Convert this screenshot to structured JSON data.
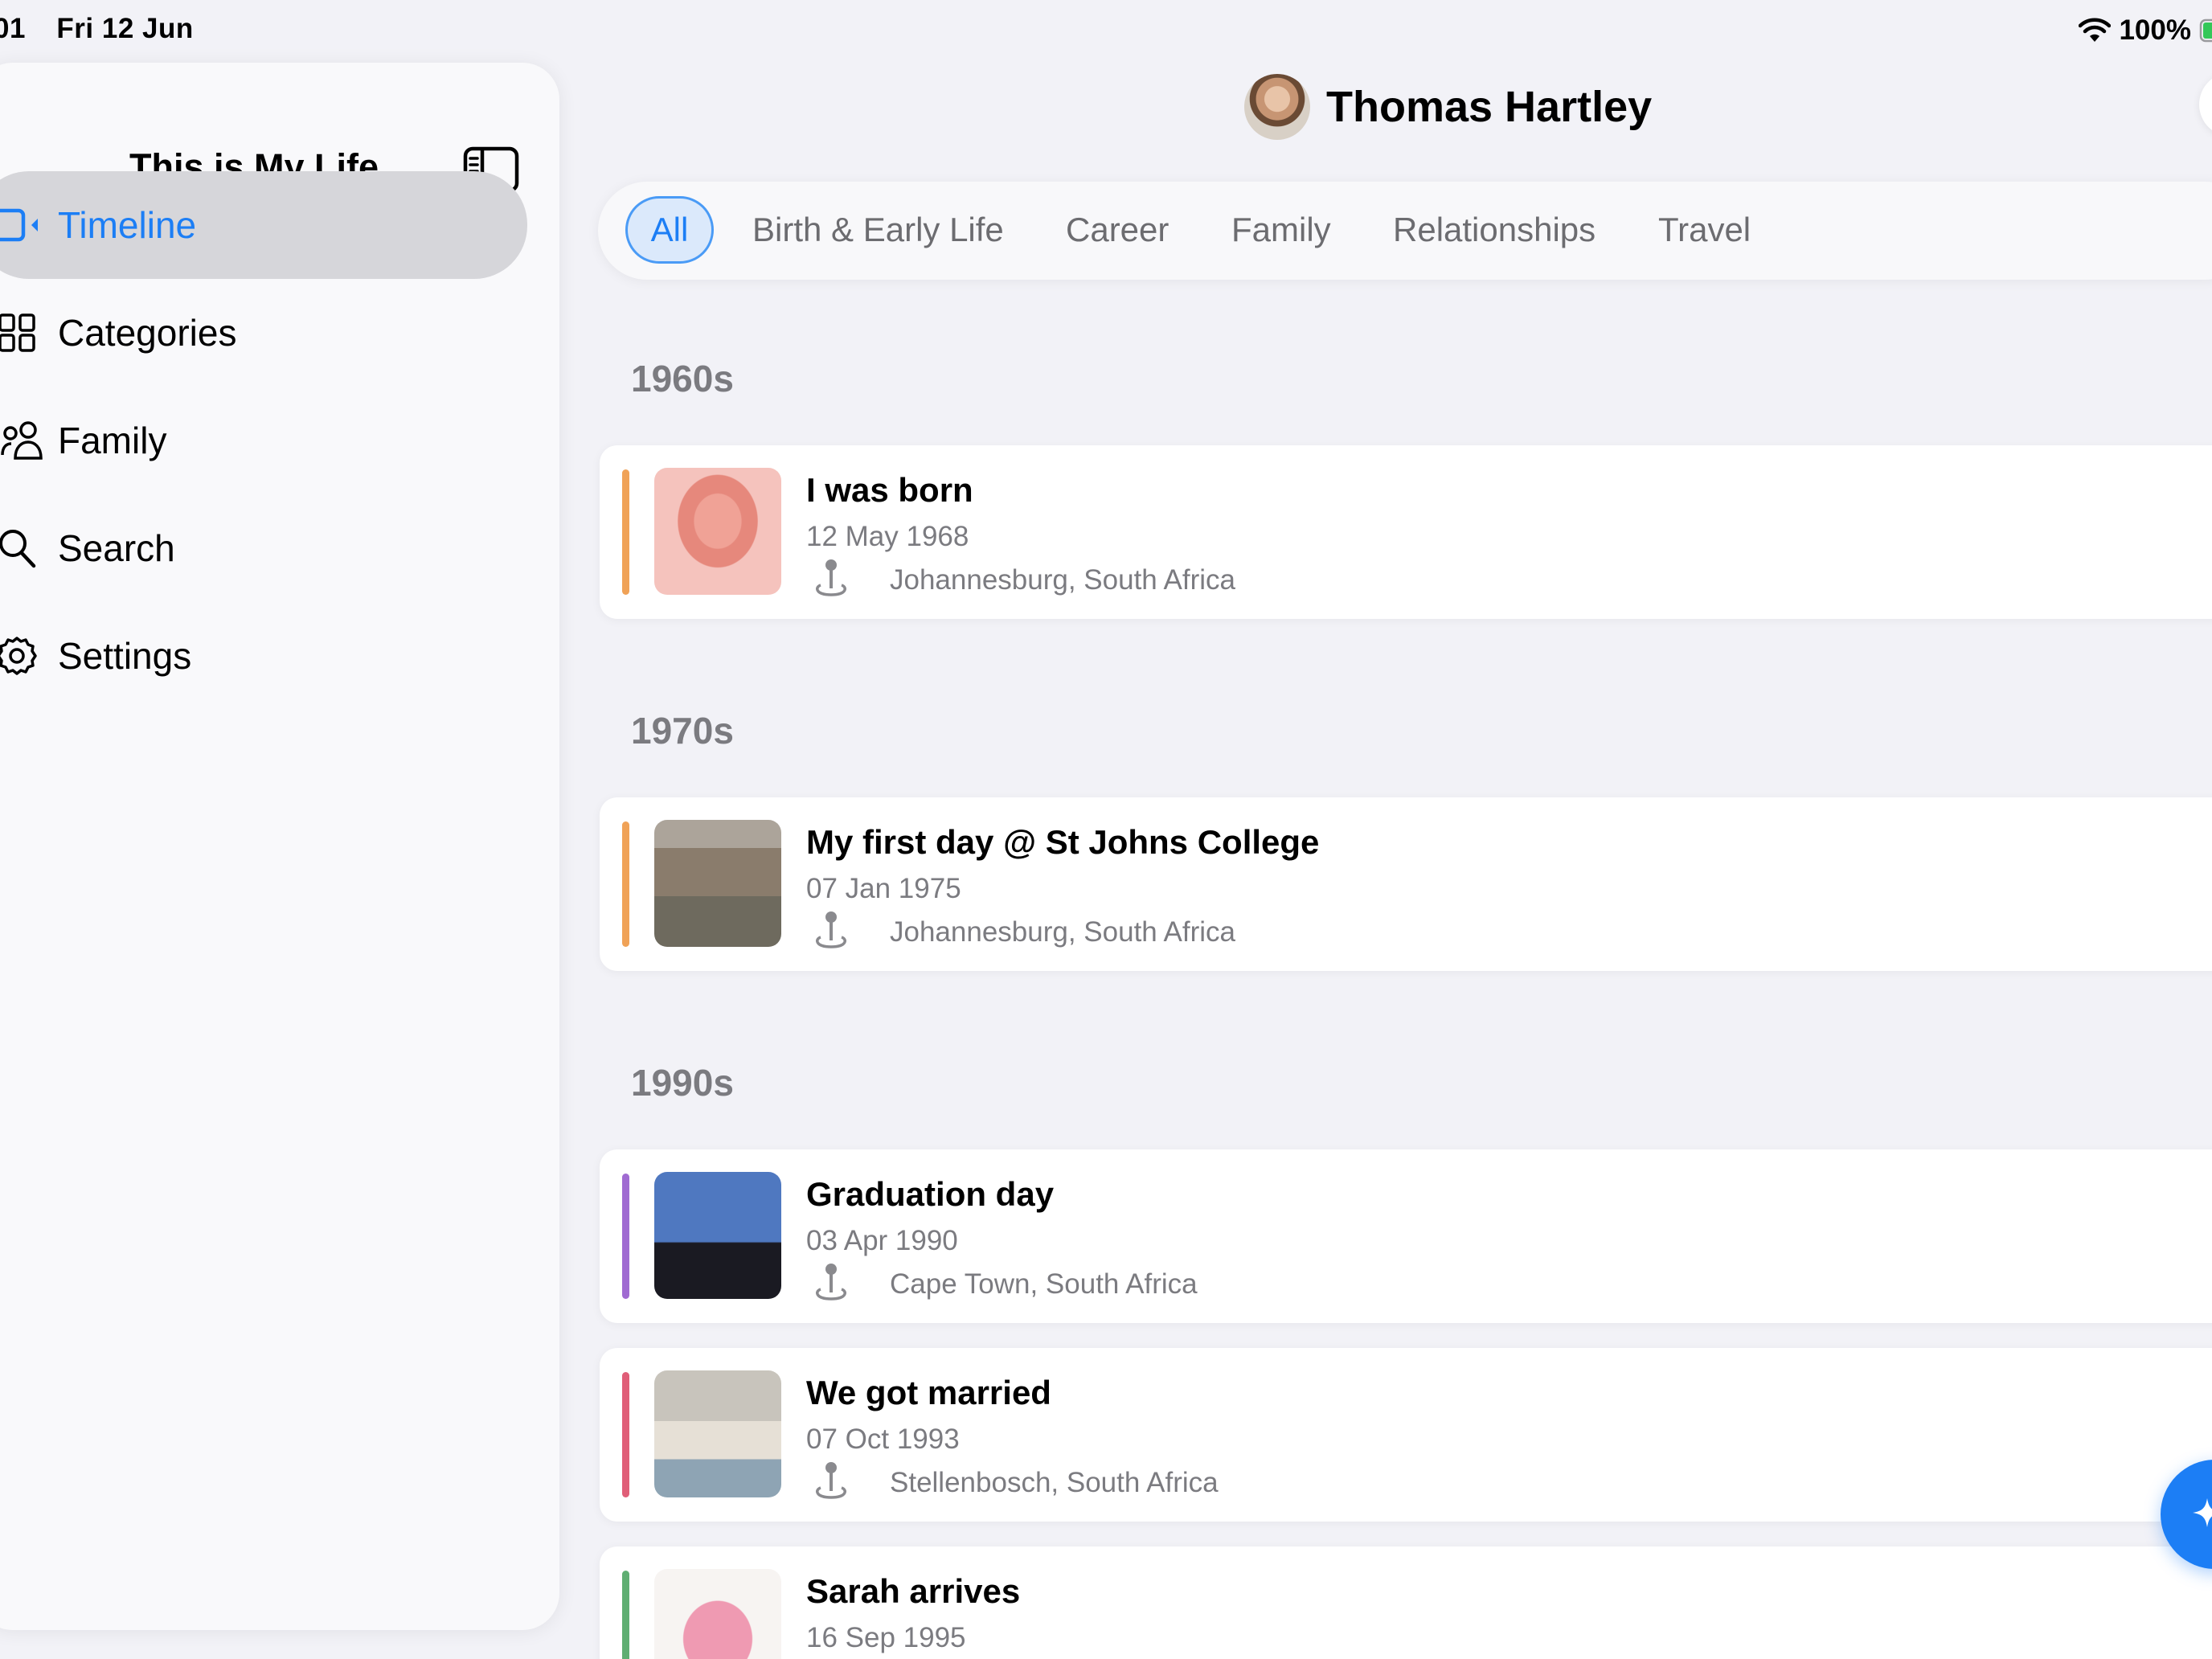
{
  "status_bar": {
    "time": "01",
    "date": "Fri 12 Jun",
    "battery": "100%"
  },
  "sidebar": {
    "title": "This is My Life",
    "items": [
      {
        "label": "Timeline",
        "icon": "timeline-icon",
        "active": true
      },
      {
        "label": "Categories",
        "icon": "grid-icon",
        "active": false
      },
      {
        "label": "Family",
        "icon": "people-icon",
        "active": false
      },
      {
        "label": "Search",
        "icon": "search-icon",
        "active": false
      },
      {
        "label": "Settings",
        "icon": "gear-icon",
        "active": false
      }
    ]
  },
  "header": {
    "name": "Thomas Hartley"
  },
  "filters": [
    {
      "label": "All",
      "active": true
    },
    {
      "label": "Birth & Early Life",
      "active": false
    },
    {
      "label": "Career",
      "active": false
    },
    {
      "label": "Family",
      "active": false
    },
    {
      "label": "Relationships",
      "active": false
    },
    {
      "label": "Travel",
      "active": false
    }
  ],
  "decades": [
    {
      "label": "1960s"
    },
    {
      "label": "1970s"
    },
    {
      "label": "1990s"
    }
  ],
  "events": [
    {
      "title": "I was born",
      "date": "12 May 1968",
      "location": "Johannesburg, South Africa",
      "color": "#f0a257"
    },
    {
      "title": "My first day @ St Johns College",
      "date": "07 Jan 1975",
      "location": "Johannesburg, South Africa",
      "color": "#f0a257"
    },
    {
      "title": "Graduation day",
      "date": "03 Apr 1990",
      "location": "Cape Town, South Africa",
      "color": "#a06bd2"
    },
    {
      "title": "We got married",
      "date": "07 Oct 1993",
      "location": "Stellenbosch, South Africa",
      "color": "#e05e78"
    },
    {
      "title": "Sarah arrives",
      "date": "16 Sep 1995",
      "location": "",
      "color": "#5fae72"
    }
  ],
  "colors": {
    "accent": "#1c7ef5",
    "secondary_text": "#7b7b80",
    "background": "#f2f2f7"
  }
}
